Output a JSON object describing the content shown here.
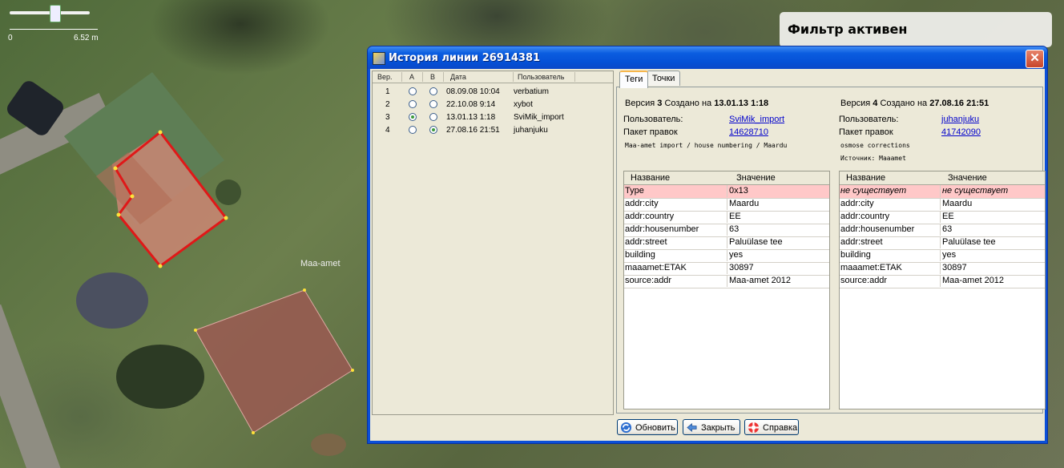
{
  "map": {
    "filter_banner": "Фильтр активен",
    "scale_left": "0",
    "scale_right": "6.52 m",
    "imagery_label": "Maa-amet"
  },
  "dialog": {
    "title": "История линии 26914381",
    "close_glyph": "✕",
    "list": {
      "headers": {
        "ver": "Вер.",
        "a": "A",
        "b": "B",
        "date": "Дата",
        "user": "Пользователь"
      },
      "rows": [
        {
          "ver": "1",
          "a": false,
          "b": false,
          "date": "08.09.08 10:04",
          "user": "verbatium"
        },
        {
          "ver": "2",
          "a": false,
          "b": false,
          "date": "22.10.08 9:14",
          "user": "xybot"
        },
        {
          "ver": "3",
          "a": true,
          "b": false,
          "date": "13.01.13 1:18",
          "user": "SviMik_import"
        },
        {
          "ver": "4",
          "a": false,
          "b": true,
          "date": "27.08.16 21:51",
          "user": "juhanjuku"
        }
      ]
    },
    "tabs": {
      "tags": "Теги",
      "nodes": "Точки"
    },
    "left_version": {
      "prefix": "Версия",
      "number": "3",
      "created_label": "Создано на",
      "created": "13.01.13 1:18",
      "user_label": "Пользователь:",
      "user": "SviMik_import",
      "changeset_label": "Пакет правок",
      "changeset": "14628710",
      "comment": "Maa-amet import / house numbering / Maardu",
      "source": ""
    },
    "right_version": {
      "prefix": "Версия",
      "number": "4",
      "created_label": "Создано на",
      "created": "27.08.16 21:51",
      "user_label": "Пользователь:",
      "user": "juhanjuku",
      "changeset_label": "Пакет правок",
      "changeset": "41742090",
      "comment": "osmose corrections",
      "source": "Источник: Maaamet"
    },
    "table_headers": {
      "name": "Название",
      "value": "Значение"
    },
    "left_tags": [
      {
        "k": "Type",
        "v": "0x13",
        "diff": true
      },
      {
        "k": "addr:city",
        "v": "Maardu"
      },
      {
        "k": "addr:country",
        "v": "EE"
      },
      {
        "k": "addr:housenumber",
        "v": "63"
      },
      {
        "k": "addr:street",
        "v": "Paluülase tee"
      },
      {
        "k": "building",
        "v": "yes"
      },
      {
        "k": "maaamet:ETAK",
        "v": "30897"
      },
      {
        "k": "source:addr",
        "v": "Maa-amet 2012"
      }
    ],
    "right_tags": [
      {
        "k": "не существует",
        "v": "не существует",
        "diff": true
      },
      {
        "k": "addr:city",
        "v": "Maardu"
      },
      {
        "k": "addr:country",
        "v": "EE"
      },
      {
        "k": "addr:housenumber",
        "v": "63"
      },
      {
        "k": "addr:street",
        "v": "Paluülase tee"
      },
      {
        "k": "building",
        "v": "yes"
      },
      {
        "k": "maaamet:ETAK",
        "v": "30897"
      },
      {
        "k": "source:addr",
        "v": "Maa-amet 2012"
      }
    ],
    "buttons": {
      "refresh": "Обновить",
      "close": "Закрыть",
      "help": "Справка"
    },
    "colors": {
      "diff_row": "#ffc8c8",
      "title_bar": "#0550d6",
      "link": "#0000cc"
    }
  }
}
